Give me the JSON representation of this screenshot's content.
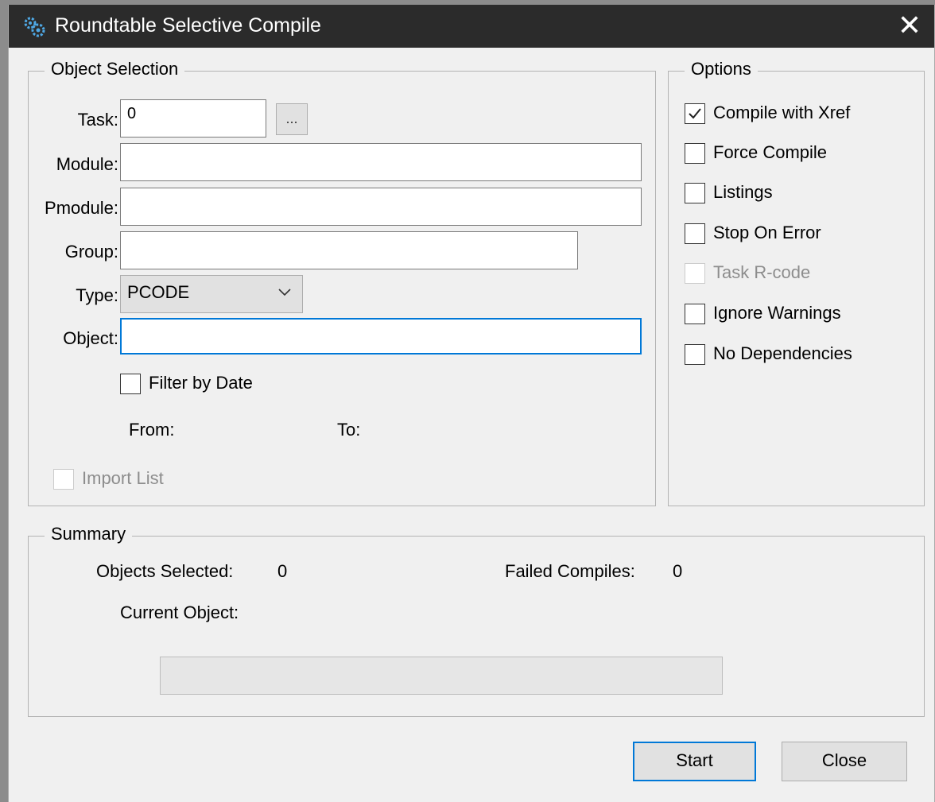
{
  "window": {
    "title": "Roundtable Selective Compile",
    "close_glyph": "✕"
  },
  "object_selection": {
    "legend": "Object Selection",
    "task_label": "Task:",
    "task_value": "0",
    "browse_label": "...",
    "module_label": "Module:",
    "module_value": "",
    "pmodule_label": "Pmodule:",
    "pmodule_value": "",
    "group_label": "Group:",
    "group_value": "",
    "type_label": "Type:",
    "type_value": "PCODE",
    "object_label": "Object:",
    "object_value": "",
    "filter_by_date": {
      "label": "Filter by Date",
      "checked": false
    },
    "from_label": "From:",
    "to_label": "To:",
    "import_list": {
      "label": "Import List",
      "checked": false,
      "enabled": false
    }
  },
  "options": {
    "legend": "Options",
    "items": [
      {
        "label": "Compile with Xref",
        "checked": true,
        "enabled": true
      },
      {
        "label": "Force Compile",
        "checked": false,
        "enabled": true
      },
      {
        "label": "Listings",
        "checked": false,
        "enabled": true
      },
      {
        "label": "Stop On Error",
        "checked": false,
        "enabled": true
      },
      {
        "label": "Task R-code",
        "checked": false,
        "enabled": false
      },
      {
        "label": "Ignore Warnings",
        "checked": false,
        "enabled": true
      },
      {
        "label": "No Dependencies",
        "checked": false,
        "enabled": true
      }
    ]
  },
  "summary": {
    "legend": "Summary",
    "objects_selected_label": "Objects Selected:",
    "objects_selected_value": "0",
    "failed_compiles_label": "Failed Compiles:",
    "failed_compiles_value": "0",
    "current_object_label": "Current Object:",
    "current_object_value": "",
    "progress_fraction": 0
  },
  "buttons": {
    "start_label": "Start",
    "close_label": "Close"
  },
  "icons": {
    "app": "gears-icon",
    "close": "close-icon",
    "combo_arrow": "chevron-down-icon",
    "check": "checkmark-icon"
  },
  "colors": {
    "titlebar": "#2b2b2b",
    "focus_border": "#0078d7",
    "dialog_background": "#f0f0f0",
    "app_icon": "#4fa9e6"
  }
}
